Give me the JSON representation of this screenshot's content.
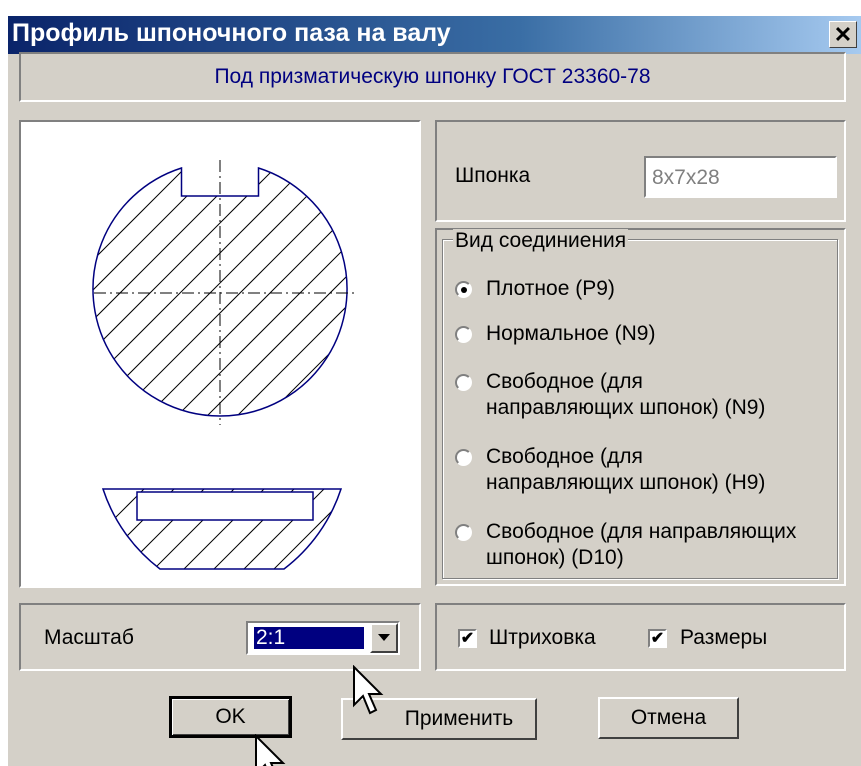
{
  "window": {
    "title": "Профиль шпоночного паза на валу",
    "close_icon": "close-icon"
  },
  "header": {
    "text": "Под призматическую шпонку ГОСТ 23360-78"
  },
  "key": {
    "label": "Шпонка",
    "value": "8x7x28"
  },
  "connection": {
    "legend": "Вид соединиения",
    "selected_index": 0,
    "options": [
      {
        "line1": "Плотное (P9)",
        "line2": ""
      },
      {
        "line1": "Нормальное (N9)",
        "line2": ""
      },
      {
        "line1": "Свободное (для",
        "line2": "направляющих шпонок) (N9)"
      },
      {
        "line1": "Свободное (для",
        "line2": "направляющих шпонок) (H9)"
      },
      {
        "line1": "Свободное (для направляющих",
        "line2": "шпонок) (D10)"
      }
    ]
  },
  "scale": {
    "label": "Масштаб",
    "value": "2:1"
  },
  "options": {
    "hatching_label": "Штриховка",
    "hatching_checked": true,
    "dimensions_label": "Размеры",
    "dimensions_checked": true
  },
  "buttons": {
    "ok": "OK",
    "apply": "Применить",
    "cancel": "Отмена"
  },
  "colors": {
    "selection": "#000080",
    "drawing_line": "#000080",
    "title_bar": "#0a246a"
  }
}
